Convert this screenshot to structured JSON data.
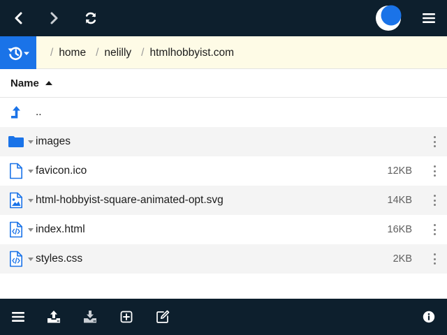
{
  "topbar": {
    "back_icon": "chevron-left-icon",
    "forward_icon": "chevron-right-icon",
    "refresh_icon": "refresh-icon",
    "theme_icon": "moon-icon",
    "menu_icon": "hamburger-menu-icon"
  },
  "pathbar": {
    "history_icon": "history-icon",
    "crumbs": [
      "home",
      "nelilly",
      "htmlhobbyist.com"
    ],
    "separator": "/"
  },
  "columns": {
    "name_label": "Name",
    "sort": "ascending"
  },
  "rows": [
    {
      "name": "..",
      "size": "",
      "icon": "parent-folder-arrow-icon",
      "kind": "parent"
    },
    {
      "name": "images",
      "size": "",
      "icon": "folder-icon",
      "kind": "folder"
    },
    {
      "name": "favicon.ico",
      "size": "12KB",
      "icon": "file-icon",
      "kind": "file"
    },
    {
      "name": "html-hobbyist-square-animated-opt.svg",
      "size": "14KB",
      "icon": "image-file-icon",
      "kind": "image"
    },
    {
      "name": "index.html",
      "size": "16KB",
      "icon": "code-file-icon",
      "kind": "code"
    },
    {
      "name": "styles.css",
      "size": "2KB",
      "icon": "code-file-icon",
      "kind": "code"
    }
  ],
  "bottombar": {
    "menu_icon": "hamburger-menu-icon",
    "upload_icon": "upload-icon",
    "download_icon": "download-icon",
    "new_icon": "plus-box-icon",
    "edit_icon": "edit-icon",
    "info_icon": "info-icon"
  },
  "colors": {
    "bar_bg": "#0d1f2d",
    "accent": "#1a73e8",
    "path_bg": "#fefbe6",
    "alt_row": "#f4f4f4"
  }
}
